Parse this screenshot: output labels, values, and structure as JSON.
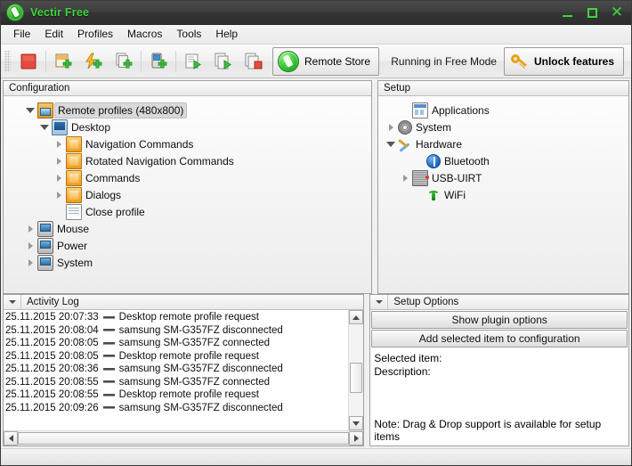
{
  "window": {
    "title": "Vectir Free",
    "icon": "vectir-remote-icon",
    "buttons": {
      "minimize": "minimize-icon",
      "maximize": "maximize-icon",
      "close": "close-icon"
    }
  },
  "menubar": {
    "items": [
      "File",
      "Edit",
      "Profiles",
      "Macros",
      "Tools",
      "Help"
    ]
  },
  "toolbar": {
    "buttons": [
      {
        "name": "stop-button",
        "icon": "red-square-icon"
      },
      {
        "name": "new-profile-button",
        "icon": "folder-add-icon"
      },
      {
        "name": "new-macro-button",
        "icon": "lightning-add-icon"
      },
      {
        "name": "new-command-set-button",
        "icon": "pages-add-icon"
      },
      {
        "name": "new-device-button",
        "icon": "device-add-icon"
      },
      {
        "name": "run-page-button",
        "icon": "page-play-icon"
      },
      {
        "name": "run-pages-button",
        "icon": "pages-play-icon"
      },
      {
        "name": "stop-pages-button",
        "icon": "pages-stop-icon"
      }
    ],
    "remote_store_label": "Remote Store",
    "remote_store_icon": "vectir-remote-icon",
    "free_mode_label": "Running in Free Mode",
    "unlock_label": "Unlock features",
    "unlock_icon": "key-icon"
  },
  "configuration": {
    "header": "Configuration",
    "tree": [
      {
        "label": "Remote profiles (480x800)",
        "icon": "profiles-icon",
        "depth": 0,
        "state": "expanded",
        "selected": true
      },
      {
        "label": "Desktop",
        "icon": "desktop-icon",
        "depth": 1,
        "state": "expanded",
        "selected": false
      },
      {
        "label": "Navigation Commands",
        "icon": "folder-icon",
        "depth": 2,
        "state": "collapsed",
        "selected": false
      },
      {
        "label": "Rotated Navigation Commands",
        "icon": "folder-icon",
        "depth": 2,
        "state": "collapsed",
        "selected": false
      },
      {
        "label": "Commands",
        "icon": "folder-icon",
        "depth": 2,
        "state": "collapsed",
        "selected": false
      },
      {
        "label": "Dialogs",
        "icon": "folder-icon",
        "depth": 2,
        "state": "collapsed",
        "selected": false
      },
      {
        "label": "Close profile",
        "icon": "document-icon",
        "depth": 2,
        "state": "leaf",
        "selected": false
      },
      {
        "label": "Mouse",
        "icon": "device-icon",
        "depth": 1,
        "state": "collapsed",
        "selected": false
      },
      {
        "label": "Power",
        "icon": "device-icon",
        "depth": 1,
        "state": "collapsed",
        "selected": false
      },
      {
        "label": "System",
        "icon": "device-icon",
        "depth": 1,
        "state": "collapsed",
        "selected": false
      }
    ]
  },
  "setup": {
    "header": "Setup",
    "tree": [
      {
        "label": "Applications",
        "icon": "applications-icon",
        "depth": 0,
        "state": "leaf"
      },
      {
        "label": "System",
        "icon": "gear-icon",
        "depth": 0,
        "state": "collapsed"
      },
      {
        "label": "Hardware",
        "icon": "tools-icon",
        "depth": 0,
        "state": "expanded"
      },
      {
        "label": "Bluetooth",
        "icon": "bluetooth-icon",
        "depth": 1,
        "state": "leaf"
      },
      {
        "label": "USB-UIRT",
        "icon": "usb-uirt-icon",
        "depth": 1,
        "state": "collapsed"
      },
      {
        "label": "WiFi",
        "icon": "wifi-icon",
        "depth": 1,
        "state": "leaf"
      }
    ]
  },
  "activity_log": {
    "header": "Activity Log",
    "collapse_icon": "chevron-down-icon",
    "rows": [
      {
        "timestamp": "25.11.2015 20:07:33",
        "message": "Desktop remote profile request"
      },
      {
        "timestamp": "25.11.2015 20:08:04",
        "message": "samsung SM-G357FZ disconnected"
      },
      {
        "timestamp": "25.11.2015 20:08:05",
        "message": "samsung SM-G357FZ connected"
      },
      {
        "timestamp": "25.11.2015 20:08:05",
        "message": "Desktop remote profile request"
      },
      {
        "timestamp": "25.11.2015 20:08:36",
        "message": "samsung SM-G357FZ disconnected"
      },
      {
        "timestamp": "25.11.2015 20:08:55",
        "message": "samsung SM-G357FZ connected"
      },
      {
        "timestamp": "25.11.2015 20:08:55",
        "message": "Desktop remote profile request"
      },
      {
        "timestamp": "25.11.2015 20:09:26",
        "message": "samsung SM-G357FZ disconnected"
      }
    ]
  },
  "setup_options": {
    "header": "Setup Options",
    "collapse_icon": "chevron-down-icon",
    "show_plugin_options": "Show plugin options",
    "add_selected_item": "Add selected item to configuration",
    "selected_item_label": "Selected item:",
    "description_label": "Description:",
    "note": "Note: Drag & Drop support is available for setup items"
  },
  "colors": {
    "titlebar_text": "#3ed53e",
    "titlebar_bg": "#3a3a3a",
    "panel_bg": "#f0f0f0",
    "accent_green": "#2eb52e",
    "accent_orange": "#e8a020"
  }
}
